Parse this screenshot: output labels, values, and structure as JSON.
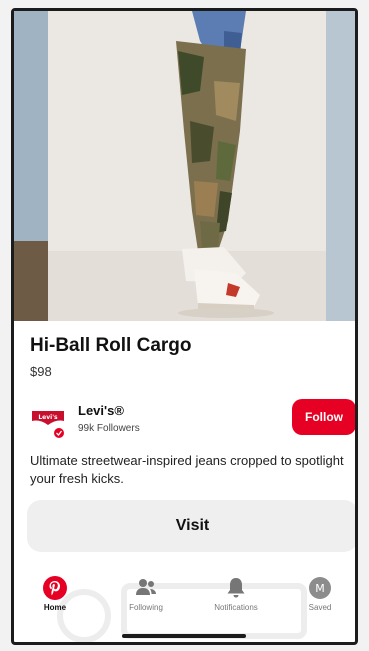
{
  "product": {
    "title": "Hi-Ball Roll Cargo",
    "price": "$98"
  },
  "brand": {
    "name": "Levi's®",
    "followers": "99k Followers",
    "follow_label": "Follow",
    "logo_icon": "levis-logo-icon"
  },
  "description": "Ultimate streetwear-inspired jeans cropped to spotlight your fresh kicks.",
  "visit_label": "Visit",
  "nav": {
    "items": [
      {
        "label": "Home",
        "icon": "pinterest-icon",
        "active": true
      },
      {
        "label": "Following",
        "icon": "people-icon",
        "active": false
      },
      {
        "label": "Notifications",
        "icon": "bell-icon",
        "active": false
      },
      {
        "label": "Saved",
        "icon": "avatar-icon",
        "active": false
      }
    ],
    "avatar_initial": "M"
  },
  "colors": {
    "accent": "#e60023",
    "visit_bg": "#efefef",
    "text": "#111111"
  }
}
